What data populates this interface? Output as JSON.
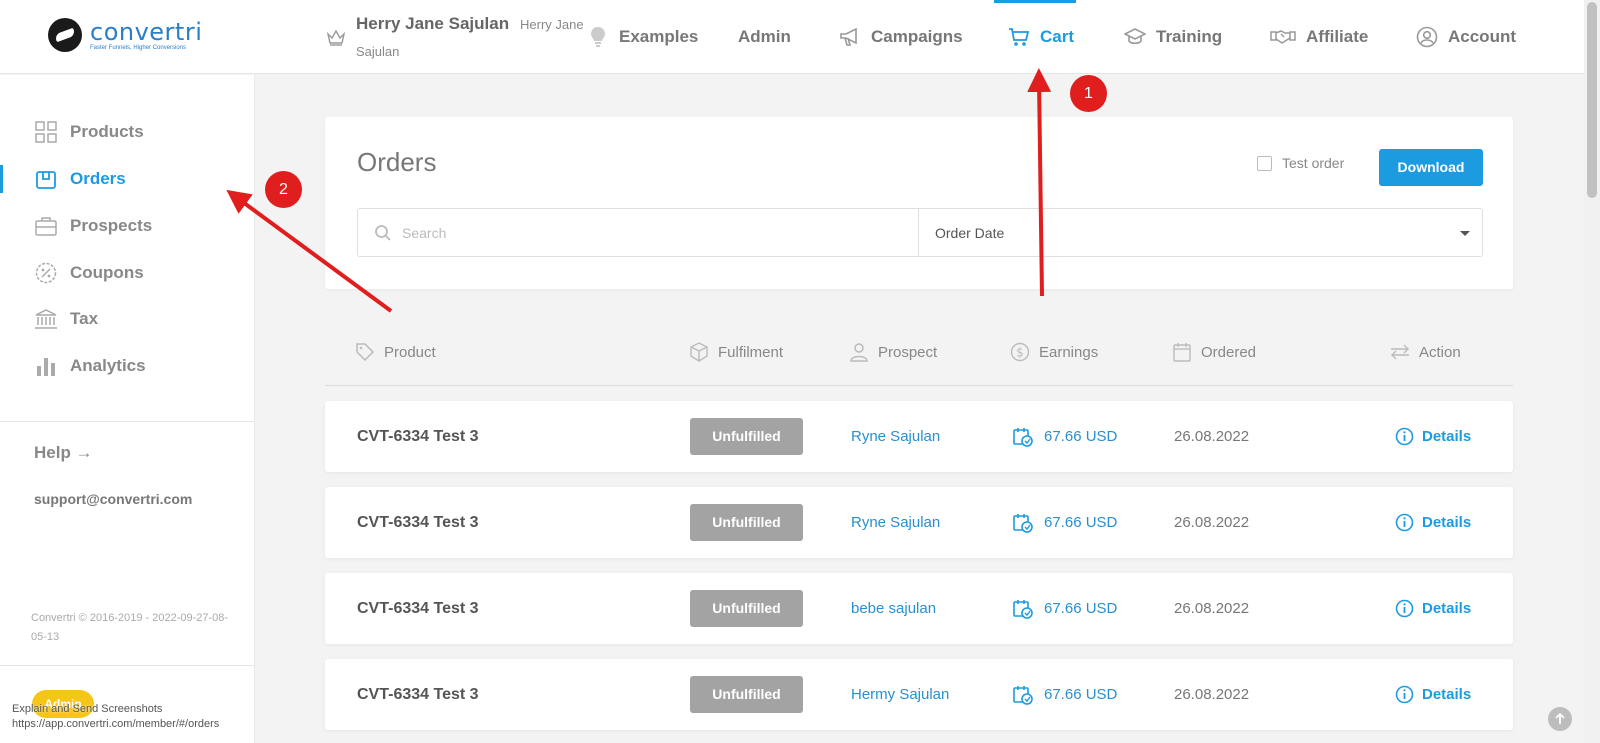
{
  "brand": {
    "name": "convertri",
    "tagline": "Faster Funnels, Higher Conversions"
  },
  "user": {
    "name": "Herry Jane Sajulan",
    "sub_line1": "Herry Jane",
    "sub_line2": "Sajulan"
  },
  "topnav": [
    {
      "label": "Examples",
      "icon": "lightbulb-icon"
    },
    {
      "label": "Admin",
      "icon": ""
    },
    {
      "label": "Campaigns",
      "icon": "megaphone-icon"
    },
    {
      "label": "Cart",
      "icon": "cart-icon",
      "active": true
    },
    {
      "label": "Training",
      "icon": "graduation-cap-icon"
    },
    {
      "label": "Affiliate",
      "icon": "handshake-icon"
    },
    {
      "label": "Account",
      "icon": "user-circle-icon"
    }
  ],
  "sidebar": {
    "items": [
      {
        "label": "Products",
        "icon": "grid-icon"
      },
      {
        "label": "Orders",
        "icon": "box-icon",
        "active": true
      },
      {
        "label": "Prospects",
        "icon": "briefcase-icon"
      },
      {
        "label": "Coupons",
        "icon": "percent-badge-icon"
      },
      {
        "label": "Tax",
        "icon": "bank-icon"
      },
      {
        "label": "Analytics",
        "icon": "bar-chart-icon"
      }
    ],
    "help": "Help →",
    "support": "support@convertri.com",
    "copyright": "Convertri © 2016-2019 - 2022-09-27-08-05-13",
    "badge": "Admin",
    "overlay_text1": "Explain and Send Screenshots",
    "overlay_text2": "https://app.convertri.com/member/#/orders"
  },
  "orders_card": {
    "title": "Orders",
    "test_order_label": "Test order",
    "download_label": "Download",
    "search_placeholder": "Search",
    "sort_selected": "Order Date"
  },
  "table": {
    "headers": [
      {
        "label": "Product",
        "icon": "tag-icon"
      },
      {
        "label": "Fulfilment",
        "icon": "cube-icon"
      },
      {
        "label": "Prospect",
        "icon": "user-icon"
      },
      {
        "label": "Earnings",
        "icon": "dollar-circle-icon"
      },
      {
        "label": "Ordered",
        "icon": "calendar-icon"
      },
      {
        "label": "Action",
        "icon": "swap-arrows-icon"
      }
    ],
    "rows": [
      {
        "product": "CVT-6334 Test 3",
        "status": "Unfulfilled",
        "prospect": "Ryne Sajulan",
        "earnings": "67.66 USD",
        "date": "26.08.2022",
        "action": "Details"
      },
      {
        "product": "CVT-6334 Test 3",
        "status": "Unfulfilled",
        "prospect": "Ryne Sajulan",
        "earnings": "67.66 USD",
        "date": "26.08.2022",
        "action": "Details"
      },
      {
        "product": "CVT-6334 Test 3",
        "status": "Unfulfilled",
        "prospect": "bebe sajulan",
        "earnings": "67.66 USD",
        "date": "26.08.2022",
        "action": "Details"
      },
      {
        "product": "CVT-6334 Test 3",
        "status": "Unfulfilled",
        "prospect": "Hermy Sajulan",
        "earnings": "67.66 USD",
        "date": "26.08.2022",
        "action": "Details"
      }
    ]
  },
  "annotations": {
    "marker1": "1",
    "marker2": "2"
  },
  "colors": {
    "accent": "#1d9be0",
    "link": "#2a8fd0",
    "annotation": "#e01e1e",
    "status_badge": "#a3a3a3"
  }
}
